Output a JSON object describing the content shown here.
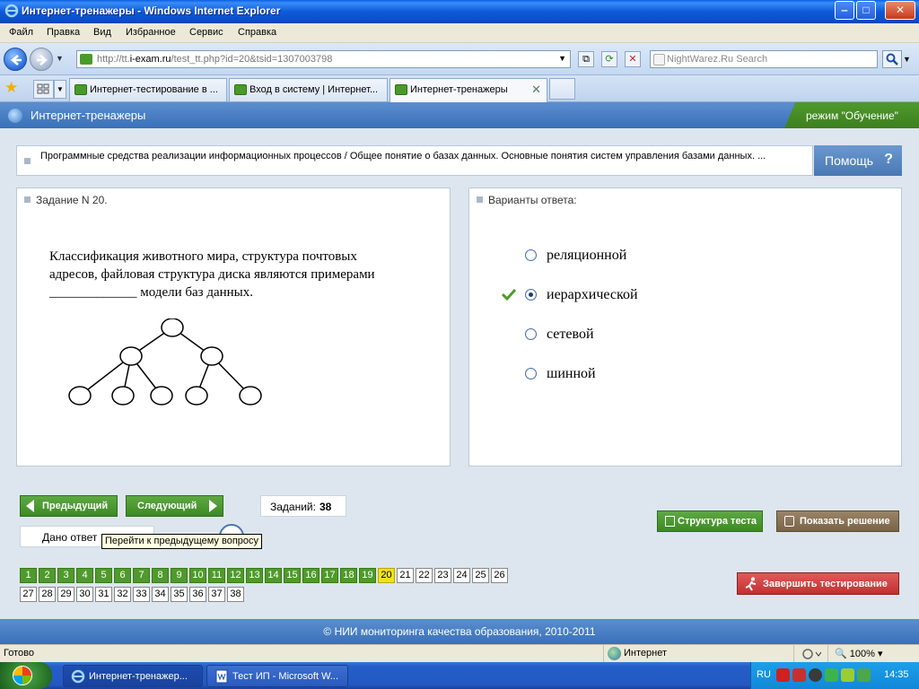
{
  "window": {
    "title": "Интернет-тренажеры - Windows Internet Explorer",
    "min": "‒",
    "max": "□",
    "close": "✕"
  },
  "menu": [
    "Файл",
    "Правка",
    "Вид",
    "Избранное",
    "Сервис",
    "Справка"
  ],
  "address": {
    "url_prefix": "http://tt.",
    "url_host": "i-exam.ru",
    "url_path": "/test_tt.php?id=20&tsid=1307003798",
    "search_placeholder": "NightWarez.Ru Search"
  },
  "tabs": [
    {
      "label": "Интернет-тестирование в ..."
    },
    {
      "label": "Вход в систему | Интернет..."
    },
    {
      "label": "Интернет-тренажеры",
      "active": true
    }
  ],
  "header": {
    "title": "Интернет-тренажеры",
    "mode": "режим \"Обучение\""
  },
  "topic": "Программные средства реализации информационных процессов / Общее понятие о базах данных. Основные понятия систем управления базами данных. ...",
  "help_label": "Помощь",
  "task": {
    "heading": "Задание N 20.",
    "question": "Классификация животного мира, структура почтовых адресов, файловая структура диска являются примерами _____________ модели баз данных."
  },
  "answers": {
    "heading": "Варианты ответа:",
    "options": [
      {
        "label": "реляционной",
        "selected": false
      },
      {
        "label": "иерархической",
        "selected": true
      },
      {
        "label": "сетевой",
        "selected": false
      },
      {
        "label": "шинной",
        "selected": false
      }
    ]
  },
  "nav": {
    "prev": "Предыдущий",
    "next": "Следующий",
    "tasks_label": "Заданий:",
    "tasks_count": "38",
    "given_answers": "Дано ответ",
    "tooltip": "Перейти к предыдущему вопросу",
    "structure": "Структура теста",
    "show_solution": "Показать решение",
    "finish": "Завершить тестирование"
  },
  "questions": {
    "total": 38,
    "answered": [
      1,
      2,
      3,
      4,
      5,
      6,
      7,
      8,
      9,
      10,
      11,
      12,
      13,
      14,
      15,
      16,
      17,
      18,
      19
    ],
    "current": 20
  },
  "footer": "© НИИ мониторинга качества образования, 2010-2011",
  "status": {
    "text": "Готово",
    "zone": "Интернет",
    "zoom": "100%"
  },
  "taskbar": {
    "items": [
      {
        "label": "Интернет-тренажер...",
        "active": true
      },
      {
        "label": "Тест ИП - Microsoft W...",
        "active": false
      }
    ],
    "lang": "RU",
    "clock": "14:35"
  },
  "colors": {
    "accent_green": "#4f9a2c",
    "header_blue": "#3a70b8",
    "current_yellow": "#f0e020",
    "finish_red": "#c23030"
  }
}
